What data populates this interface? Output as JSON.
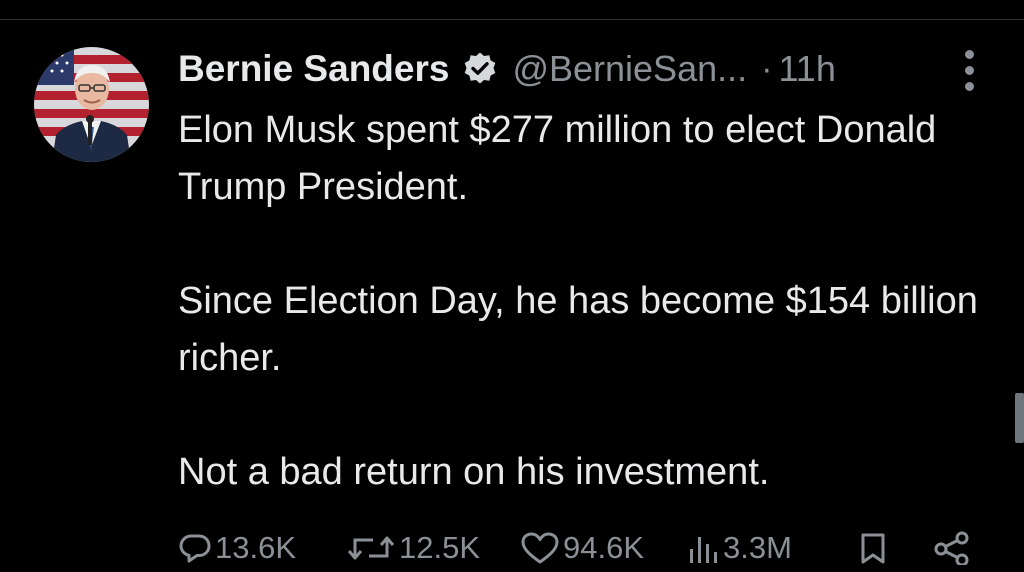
{
  "tweet": {
    "author_name": "Bernie Sanders",
    "handle": "@BernieSan...",
    "separator": "·",
    "time": "11h",
    "paragraphs": [
      "Elon Musk spent $277 million to elect Donald Trump President.",
      "Since Election Day, he has become $154 billion richer.",
      "Not a bad return on his investment."
    ],
    "verified_icon": "verified-badge-icon",
    "more_icon": "more-vertical-icon"
  },
  "actions": {
    "replies": {
      "icon": "reply-icon",
      "count": "13.6K"
    },
    "reposts": {
      "icon": "repost-icon",
      "count": "12.5K"
    },
    "likes": {
      "icon": "heart-icon",
      "count": "94.6K"
    },
    "views": {
      "icon": "views-chart-icon",
      "count": "3.3M"
    },
    "bookmark": {
      "icon": "bookmark-icon"
    },
    "share": {
      "icon": "share-icon"
    }
  },
  "colors": {
    "background": "#000000",
    "primary_text": "#e7e9ea",
    "secondary_text": "#8b9096",
    "divider": "#2f3336"
  }
}
